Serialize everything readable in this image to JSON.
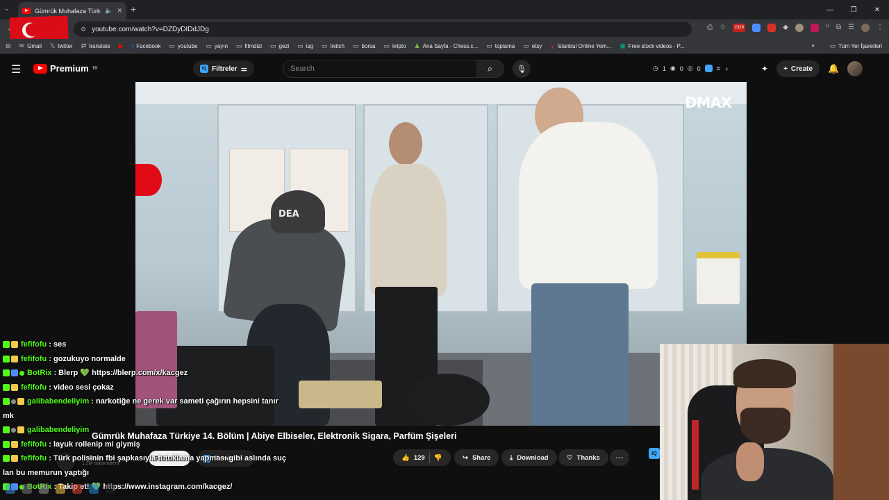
{
  "browser": {
    "tab_title": "Gümrük Muhafaza Türkiye",
    "url": "youtube.com/watch?v=DZDyDIDdJDg",
    "badge_count": "2329",
    "bookmarks": [
      {
        "label": "Gmail",
        "icon": "mail-icon"
      },
      {
        "label": "twitter",
        "icon": "x-icon"
      },
      {
        "label": "translate",
        "icon": "translate-icon"
      },
      {
        "label": "",
        "icon": "youtube-icon"
      },
      {
        "label": "Facebook",
        "icon": "facebook-icon"
      },
      {
        "label": "youtube",
        "icon": "folder-icon"
      },
      {
        "label": "yayın",
        "icon": "folder-icon"
      },
      {
        "label": "filmdizi",
        "icon": "folder-icon"
      },
      {
        "label": "gezi",
        "icon": "folder-icon"
      },
      {
        "label": "isg",
        "icon": "folder-icon"
      },
      {
        "label": "twitch",
        "icon": "folder-icon"
      },
      {
        "label": "borsa",
        "icon": "folder-icon"
      },
      {
        "label": "kripto",
        "icon": "folder-icon"
      },
      {
        "label": "Ana Sayfa - Chess.c...",
        "icon": "chess-icon"
      },
      {
        "label": "toplama",
        "icon": "folder-icon"
      },
      {
        "label": "etsy",
        "icon": "folder-icon"
      },
      {
        "label": "İstanbul Online Yem...",
        "icon": "yemek-icon"
      },
      {
        "label": "Free stock videos - P...",
        "icon": "pexels-icon"
      }
    ],
    "all_bookmarks": "Tüm Yer İşaretleri"
  },
  "youtube": {
    "logo_text": "Premium",
    "region": "TR",
    "filters_label": "Filtreler",
    "search_placeholder": "Search",
    "counters": [
      "1",
      "0",
      "0"
    ],
    "create_label": "Create"
  },
  "video": {
    "watermark": "DMAX",
    "cap_text": "DEA",
    "title": "Gümrük Muhafaza Türkiye 14. Bölüm | Abiye Elbiseler, Elektronik Sigara, Parfüm Şişeleri",
    "channel_subs": "1,2M subscribers",
    "subscribe_label": "Subscribe",
    "remix_label": "Remix",
    "likes": "129",
    "share_label": "Share",
    "download_label": "Download",
    "thanks_label": "Thanks"
  },
  "chat": [
    {
      "user": "fefifofu",
      "user_color": "#53fc18",
      "badges": [
        "b-k",
        "b-gold"
      ],
      "text": ": ses"
    },
    {
      "user": "fefifofu",
      "user_color": "#53fc18",
      "badges": [
        "b-k",
        "b-gold"
      ],
      "text": ": gozukuyo normalde"
    },
    {
      "user": "BotRix",
      "user_color": "#53fc18",
      "badges": [
        "b-k",
        "b-blue",
        "b-gbadge"
      ],
      "text": ": Blerp 💚 https://blerp.com/x/kacgez"
    },
    {
      "user": "fefifofu",
      "user_color": "#53fc18",
      "badges": [
        "b-k",
        "b-gold"
      ],
      "text": ": video sesi çokaz"
    },
    {
      "user": "galibabendeliyim",
      "user_color": "#53fc18",
      "badges": [
        "b-k",
        "b-round",
        "b-gold"
      ],
      "text": ": narkotiğe ne gerek var sameti çağırın hepsini tanır",
      "cont": "mk"
    },
    {
      "user": "galibabendeliyim",
      "user_color": "#53fc18",
      "badges": [
        "b-k",
        "b-round",
        "b-gold"
      ],
      "text": ""
    },
    {
      "user": "fefifofu",
      "user_color": "#53fc18",
      "badges": [
        "b-k",
        "b-gold"
      ],
      "text": ": layuk rollenip mi giymiş"
    },
    {
      "user": "fefifofu",
      "user_color": "#53fc18",
      "badges": [
        "b-k",
        "b-gold"
      ],
      "text": ": Türk polisinin fbi şapkasıyla tutuklama yapması gibi aslında suç",
      "cont": "lan bu memurun yaptığı"
    },
    {
      "user": "BotRix",
      "user_color": "#53fc18",
      "badges": [
        "b-k",
        "b-blue",
        "b-gbadge"
      ],
      "text": ": Takip et! 💚 https://www.instagram.com/kacgez/"
    }
  ]
}
